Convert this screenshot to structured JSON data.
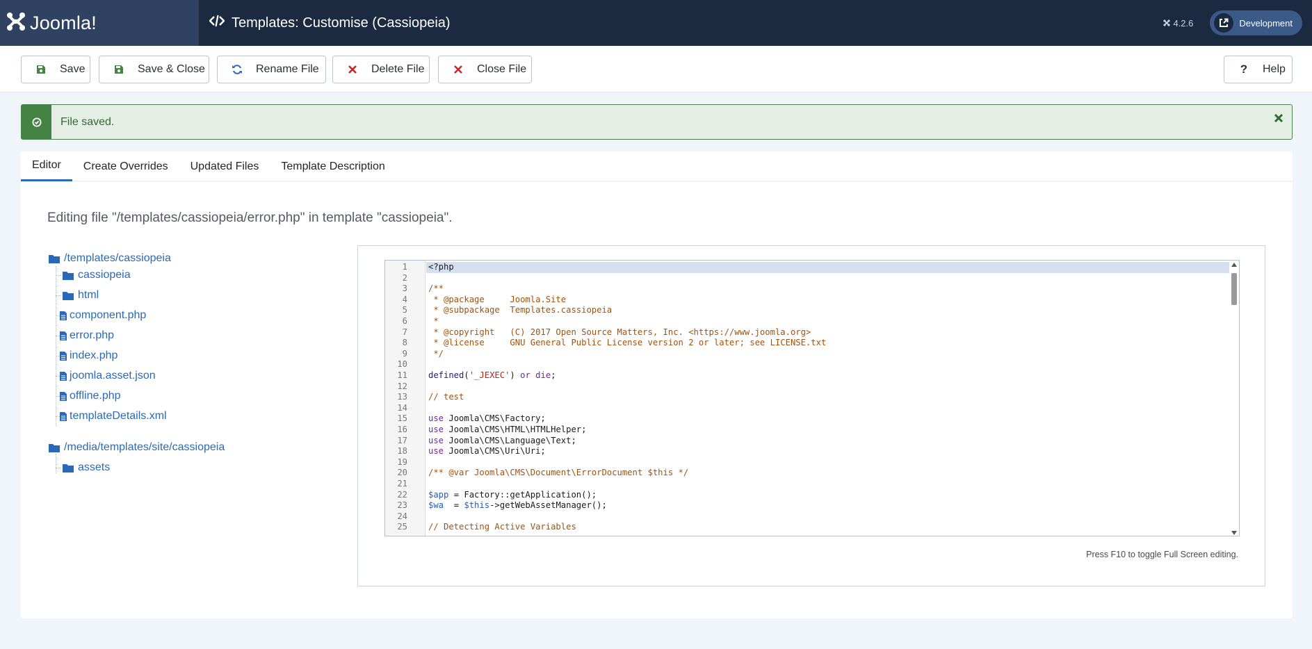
{
  "header": {
    "brand": "Joomla!",
    "title": "Templates: Customise (Cassiopeia)",
    "version": "4.2.6",
    "site_button": "Development"
  },
  "toolbar": {
    "save": "Save",
    "save_close": "Save & Close",
    "rename": "Rename File",
    "delete": "Delete File",
    "close": "Close File",
    "help": "Help"
  },
  "alert": {
    "message": "File saved."
  },
  "tabs": [
    "Editor",
    "Create Overrides",
    "Updated Files",
    "Template Description"
  ],
  "editing_label": "Editing file \"/templates/cassiopeia/error.php\" in template \"cassiopeia\".",
  "tree": {
    "root1": "/templates/cassiopeia",
    "root1_children": [
      "cassiopeia",
      "html",
      "component.php",
      "error.php",
      "index.php",
      "joomla.asset.json",
      "offline.php",
      "templateDetails.xml"
    ],
    "root2": "/media/templates/site/cassiopeia",
    "root2_children": [
      "assets"
    ]
  },
  "editor": {
    "hint": "Press F10 to toggle Full Screen editing.",
    "lines": [
      "<?php",
      "",
      "/**",
      " * @package     Joomla.Site",
      " * @subpackage  Templates.cassiopeia",
      " *",
      " * @copyright   (C) 2017 Open Source Matters, Inc. <https://www.joomla.org>",
      " * @license     GNU General Public License version 2 or later; see LICENSE.txt",
      " */",
      "",
      "defined('_JEXEC') or die;",
      "",
      "// test",
      "",
      "use Joomla\\CMS\\Factory;",
      "use Joomla\\CMS\\HTML\\HTMLHelper;",
      "use Joomla\\CMS\\Language\\Text;",
      "use Joomla\\CMS\\Uri\\Uri;",
      "",
      "/** @var Joomla\\CMS\\Document\\ErrorDocument $this */",
      "",
      "$app = Factory::getApplication();",
      "$wa  = $this->getWebAssetManager();",
      "",
      "// Detecting Active Variables"
    ]
  }
}
